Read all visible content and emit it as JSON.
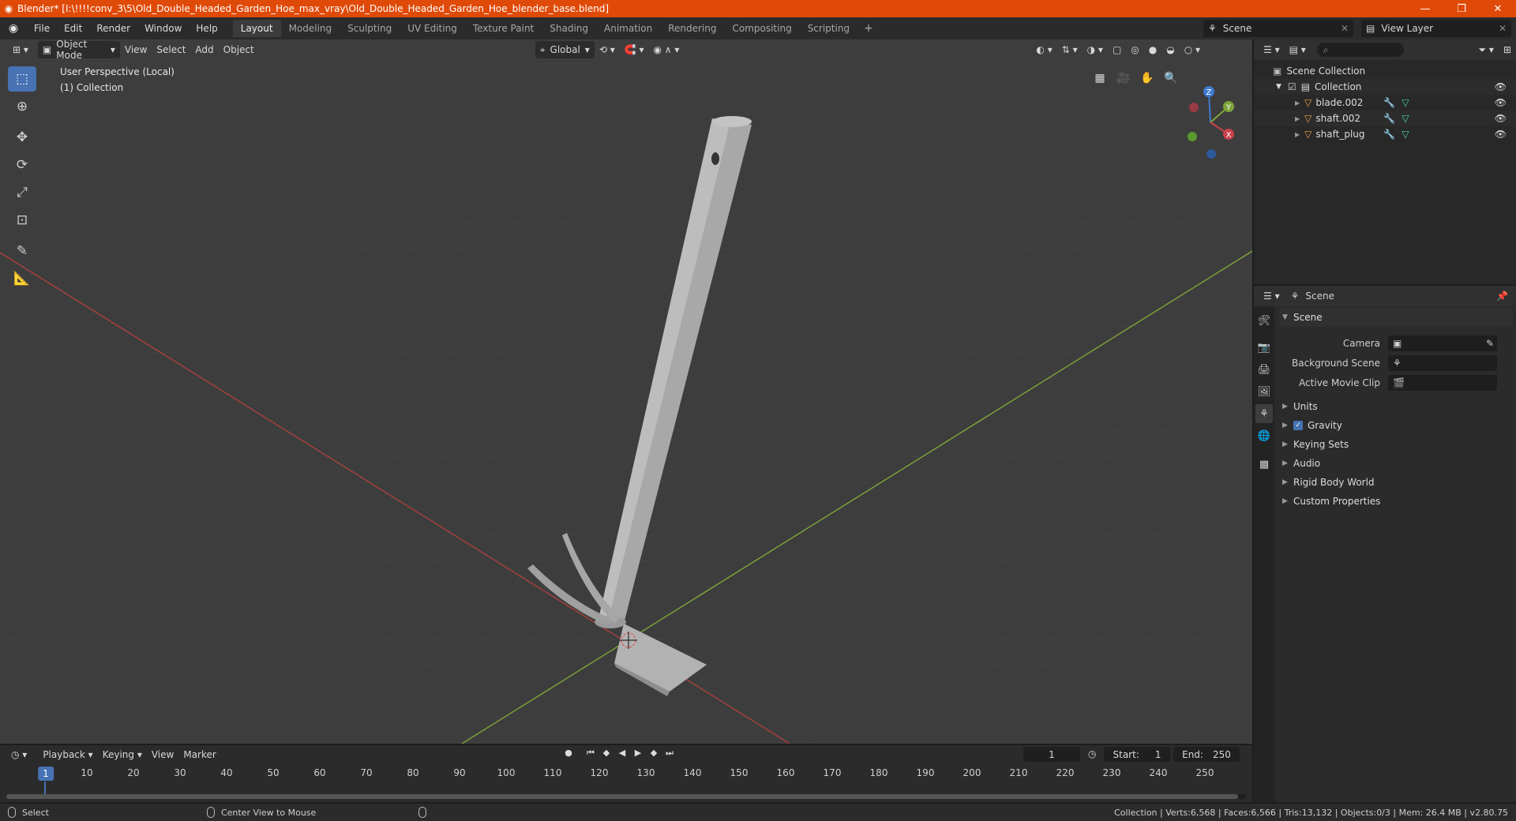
{
  "window": {
    "title": "Blender* [I:\\!!!!conv_3\\5\\Old_Double_Headed_Garden_Hoe_max_vray\\Old_Double_Headed_Garden_Hoe_blender_base.blend]",
    "minimize_icon": "minimize-icon",
    "restore_icon": "restore-icon",
    "close_icon": "close-icon"
  },
  "menubar": {
    "items": [
      "File",
      "Edit",
      "Render",
      "Window",
      "Help"
    ],
    "workspace_tabs": [
      "Layout",
      "Modeling",
      "Sculpting",
      "UV Editing",
      "Texture Paint",
      "Shading",
      "Animation",
      "Rendering",
      "Compositing",
      "Scripting"
    ],
    "active_tab": "Layout",
    "add_tab": "+",
    "scene": "Scene",
    "view_layer": "View Layer"
  },
  "viewport": {
    "mode": "Object Mode",
    "menus": [
      "View",
      "Select",
      "Add",
      "Object"
    ],
    "transform_orientation": "Global",
    "perspective_label": "User Perspective (Local)",
    "collection_label": "(1) Collection",
    "gizmo_axes": {
      "x": "X",
      "y": "Y",
      "z": "Z"
    }
  },
  "outliner": {
    "root": "Scene Collection",
    "collection": "Collection",
    "objects": [
      "blade.002",
      "shaft.002",
      "shaft_plug"
    ]
  },
  "properties": {
    "header_title": "Scene",
    "panel_title": "Scene",
    "fields": [
      {
        "label": "Camera",
        "value": ""
      },
      {
        "label": "Background Scene",
        "value": ""
      },
      {
        "label": "Active Movie Clip",
        "value": ""
      }
    ],
    "subpanels": [
      "Units",
      "Gravity",
      "Keying Sets",
      "Audio",
      "Rigid Body World",
      "Custom Properties"
    ],
    "gravity_checked": true
  },
  "timeline": {
    "menus": [
      "Playback",
      "Keying",
      "View",
      "Marker"
    ],
    "current_frame": "1",
    "start_label": "Start:",
    "start": "1",
    "end_label": "End:",
    "end": "250",
    "ticks": [
      "10",
      "20",
      "30",
      "40",
      "50",
      "60",
      "70",
      "80",
      "90",
      "100",
      "110",
      "120",
      "130",
      "140",
      "150",
      "160",
      "170",
      "180",
      "190",
      "200",
      "210",
      "220",
      "230",
      "240",
      "250"
    ],
    "cursor_label": "1"
  },
  "statusbar": {
    "select": "Select",
    "center_view": "Center View to Mouse",
    "stats": "Collection | Verts:6,568 | Faces:6,566 | Tris:13,132 | Objects:0/3 | Mem: 26.4 MB | v2.80.75"
  },
  "colors": {
    "title_bar": "#e04a08",
    "accent": "#4772b3",
    "x_axis": "#b03a3a",
    "y_axis": "#7fa53a",
    "z_axis": "#3f7ad1"
  }
}
